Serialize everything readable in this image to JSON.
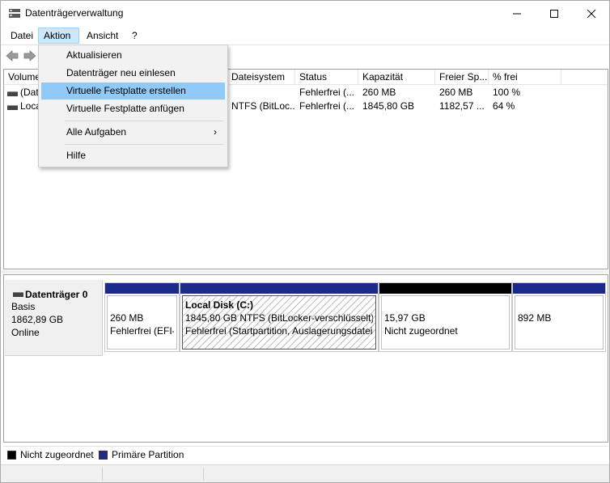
{
  "window": {
    "title": "Datenträgerverwaltung"
  },
  "menubar": [
    "Datei",
    "Aktion",
    "Ansicht",
    "?"
  ],
  "columns": [
    "Volume",
    "Dateisystem",
    "Status",
    "Kapazität",
    "Freier Sp...",
    "% frei"
  ],
  "rows": [
    {
      "volume": "(Dat",
      "filesystem": "",
      "status": "Fehlerfrei (...",
      "capacity": "260 MB",
      "free": "260 MB",
      "pct": "100 %"
    },
    {
      "volume": "Loca",
      "filesystem": "NTFS (BitLoc...",
      "status": "Fehlerfrei (...",
      "capacity": "1845,80 GB",
      "free": "1182,57 ...",
      "pct": "64 %"
    }
  ],
  "dropdown": {
    "items": [
      "Aktualisieren",
      "Datenträger neu einlesen",
      "Virtuelle Festplatte erstellen",
      "Virtuelle Festplatte anfügen",
      "Alle Aufgaben",
      "Hilfe"
    ],
    "hover_index": 2,
    "submenu_arrow": "›"
  },
  "disk": {
    "name": "Datenträger 0",
    "type": "Basis",
    "size": "1862,89 GB",
    "state": "Online"
  },
  "partitions": [
    {
      "title": "",
      "line1": "260 MB",
      "line2": "Fehlerfrei (EFI-S",
      "bar_color": "#1c2a8c"
    },
    {
      "title": "Local Disk  (C:)",
      "line1": "1845,80 GB NTFS (BitLocker-verschlüsselt)",
      "line2": "Fehlerfrei (Startpartition, Auslagerungsdatei,",
      "bar_color": "#1c2a8c"
    },
    {
      "title": "",
      "line1": "15,97 GB",
      "line2": "Nicht zugeordnet",
      "bar_color": "#000000"
    },
    {
      "title": "",
      "line1": "892 MB",
      "line2": "",
      "bar_color": "#1c2a8c"
    }
  ],
  "legend": [
    {
      "label": "Nicht zugeordnet",
      "color": "#000000"
    },
    {
      "label": "Primäre Partition",
      "color": "#1c2a8c"
    }
  ]
}
